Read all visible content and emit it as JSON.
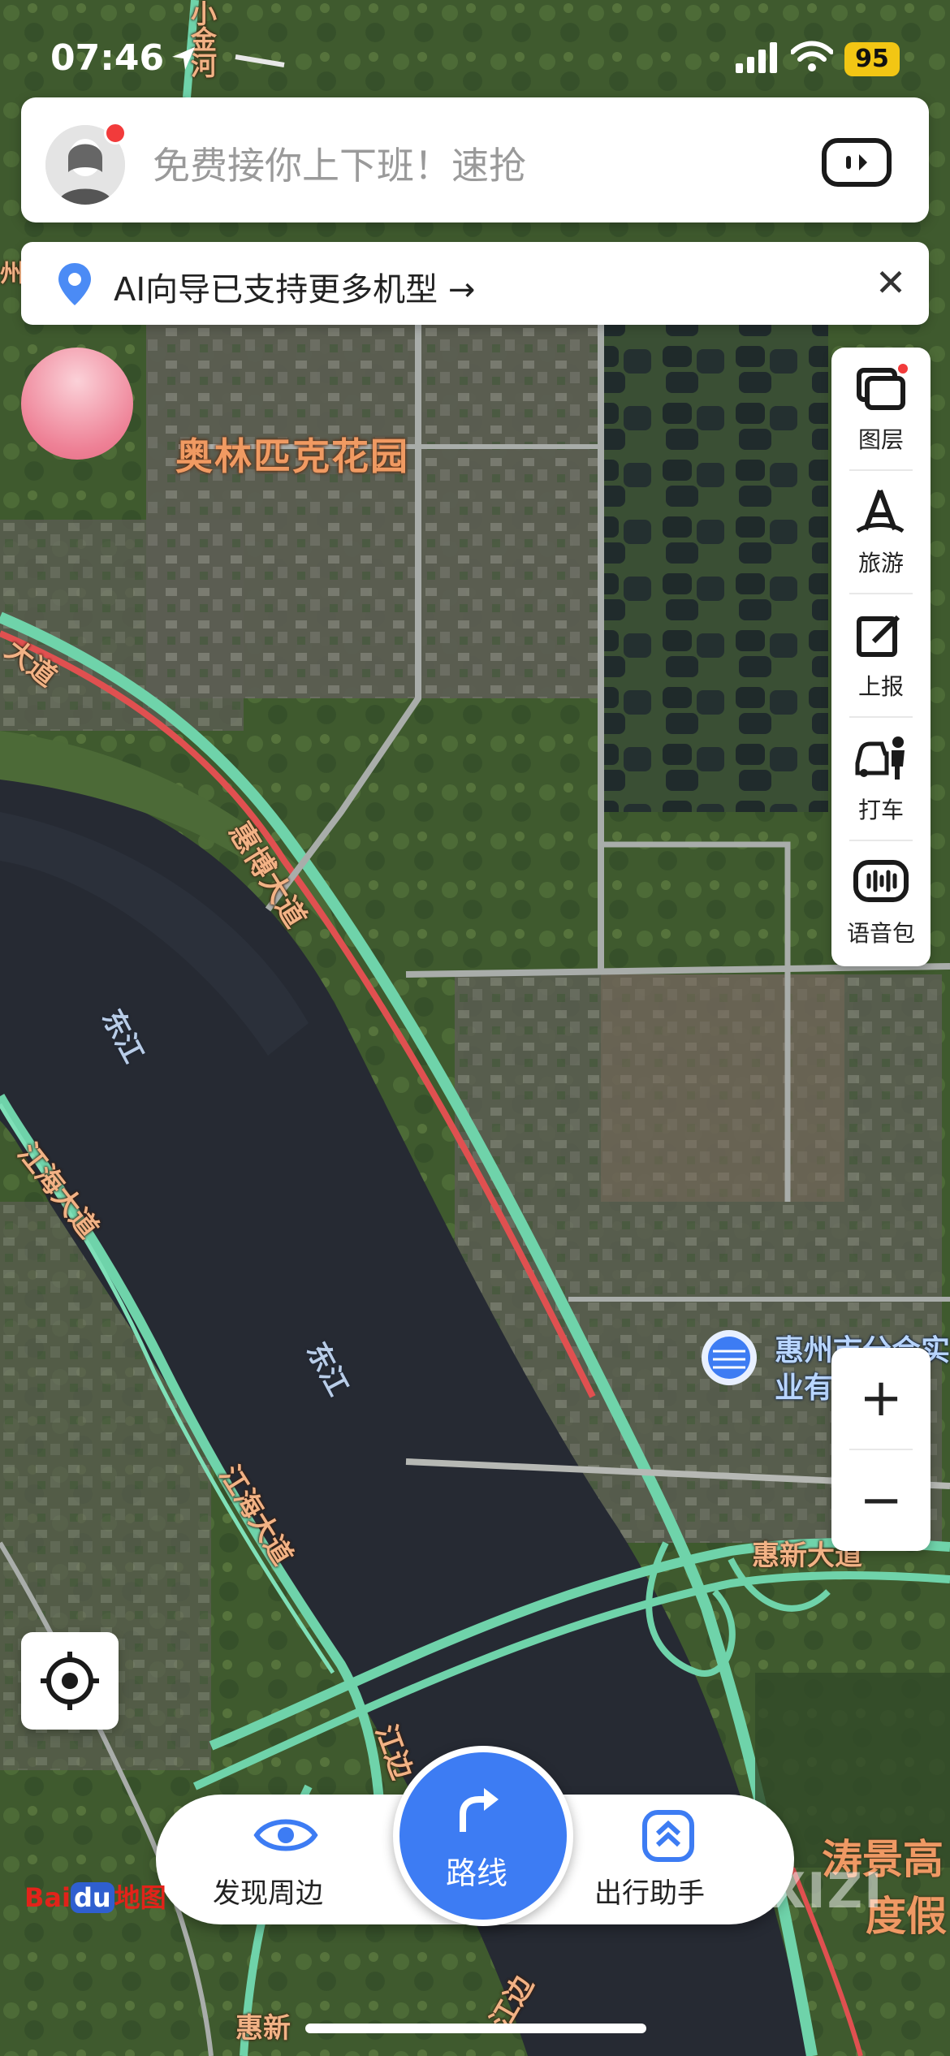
{
  "status_bar": {
    "time": "07:46",
    "battery": "95"
  },
  "search": {
    "placeholder": "免费接你上下班！速抢"
  },
  "notice": {
    "text": "AI向导已支持更多机型 →",
    "close_symbol": "✕"
  },
  "map_labels": {
    "park": "奥林匹克花园",
    "road_north": "惠博大道",
    "road_west_top": "大道",
    "road_riverside": "江海大道",
    "road_riverside_lower": "江海大道",
    "road_huixin": "惠新大道",
    "river_1": "东江",
    "river_2": "东江",
    "road_bottom_1": "江边",
    "road_bottom_2": "惠新",
    "road_bottom_3": "江边",
    "resort_1": "涛景高",
    "resort_2": "度假",
    "poi_1": "惠州市分会实",
    "poi_2": "业有",
    "left_edge": "州",
    "top_road": "小金河"
  },
  "toolbar": {
    "items": [
      {
        "label": "图层",
        "icon": "layers-icon"
      },
      {
        "label": "旅游",
        "icon": "travel-icon"
      },
      {
        "label": "上报",
        "icon": "report-icon"
      },
      {
        "label": "打车",
        "icon": "taxi-icon"
      },
      {
        "label": "语音包",
        "icon": "voice-pack-icon"
      }
    ]
  },
  "zoom": {
    "in": "+",
    "out": "−"
  },
  "bottom_bar": {
    "discover": "发现周边",
    "route": "路线",
    "assistant": "出行助手"
  },
  "branding": {
    "logo_bai": "Bai",
    "logo_du": "du",
    "logo_map": "地图",
    "watermark": "XIZI"
  },
  "colors": {
    "accent": "#3d7cf3",
    "road_green": "#7fd4b0",
    "road_red": "#e05050",
    "label_orange": "#f09a62"
  }
}
